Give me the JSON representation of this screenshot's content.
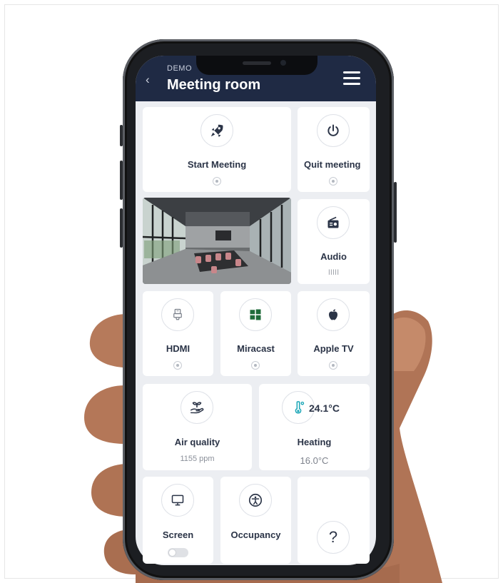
{
  "header": {
    "breadcrumb": "DEMO",
    "title": "Meeting room",
    "back_icon": "chevron-left-icon",
    "menu_icon": "hamburger-icon"
  },
  "tiles": {
    "start_meeting": {
      "label": "Start Meeting",
      "icon": "rocket-icon"
    },
    "quit_meeting": {
      "label": "Quit meeting",
      "icon": "power-icon"
    },
    "audio": {
      "label": "Audio",
      "icon": "radio-icon",
      "level": "IIIII"
    },
    "hdmi": {
      "label": "HDMI",
      "icon": "hdmi-plug-icon"
    },
    "miracast": {
      "label": "Miracast",
      "icon": "windows-icon"
    },
    "apple_tv": {
      "label": "Apple TV",
      "icon": "apple-icon"
    },
    "air_quality": {
      "label": "Air quality",
      "value": "1155 ppm",
      "icon": "plant-hand-icon"
    },
    "heating": {
      "label": "Heating",
      "current": "24.1°C",
      "setpoint": "16.0°C",
      "icon": "thermometer-icon"
    },
    "screen": {
      "label": "Screen",
      "icon": "monitor-icon"
    },
    "occupancy": {
      "label": "Occupancy",
      "icon": "person-circle-icon"
    },
    "help": {
      "label": "?",
      "icon": "question-icon"
    }
  },
  "colors": {
    "header_bg": "#1f2a44",
    "miracast_green": "#1f6b3a",
    "label": "#2b3447"
  }
}
